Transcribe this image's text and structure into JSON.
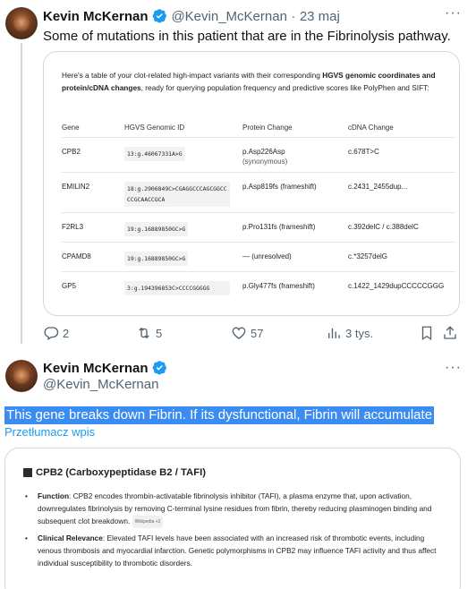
{
  "tweet1": {
    "author_name": "Kevin McKernan",
    "handle": "@Kevin_McKernan",
    "separator": "·",
    "date": "23 maj",
    "text": "Some of mutations in this patient that are in the Fibrinolysis pathway.",
    "image": {
      "intro_prefix": "Here's a table of your clot-related high-impact variants with their corresponding ",
      "intro_bold": "HGVS genomic coordinates and protein/cDNA changes",
      "intro_suffix": ", ready for querying population frequency and predictive scores like PolyPhen and SIFT:",
      "headers": [
        "Gene",
        "HGVS Genomic ID",
        "Protein Change",
        "cDNA Change"
      ],
      "rows": [
        {
          "gene": "CPB2",
          "hgvs": "13:g.46067331A>G",
          "protein": "p.Asp226Asp",
          "protein_note": "(synonymous)",
          "cdna": "c.678T>C"
        },
        {
          "gene": "EMILIN2",
          "hgvs": "18:g.2906849C>CGAGGCCCAGCGGCCCCGCAACCGCA",
          "protein": "p.Asp819fs (frameshift)",
          "protein_note": "",
          "cdna": "c.2431_2455dup..."
        },
        {
          "gene": "F2RL3",
          "hgvs": "19:g.16889850GC>G",
          "protein": "p.Pro131fs (frameshift)",
          "protein_note": "",
          "cdna": "c.392delC / c.388delC"
        },
        {
          "gene": "CPAMD8",
          "hgvs": "19:g.16889850GC>G",
          "protein": "— (unresolved)",
          "protein_note": "",
          "cdna": "c.*3257delG"
        },
        {
          "gene": "GP5",
          "hgvs": "3:g.194396853C>CCCCGGGGG",
          "protein": "p.Gly477fs (frameshift)",
          "protein_note": "",
          "cdna": "c.1422_1429dupCCCCCGGG"
        }
      ]
    },
    "actions": {
      "replies": "2",
      "reposts": "5",
      "likes": "57",
      "views": "3 tys."
    }
  },
  "tweet2": {
    "author_name": "Kevin McKernan",
    "handle": "@Kevin_McKernan",
    "text": "This gene breaks down Fibrin. If its dysfunctional, Fibrin will accumulate",
    "translate_link": "Przetłumacz wpis",
    "image": {
      "title": "CPB2 (Carboxypeptidase B2 / TAFI)",
      "bullets": [
        {
          "label": "Function",
          "text": ": CPB2 encodes thrombin-activatable fibrinolysis inhibitor (TAFI), a plasma enzyme that, upon activation, downregulates fibrinolysis by removing C-terminal lysine residues from fibrin, thereby reducing plasminogen binding and subsequent clot breakdown.",
          "cite": "Wikipedia +2"
        },
        {
          "label": "Clinical Relevance",
          "text": ": Elevated TAFI levels have been associated with an increased risk of thrombotic events, including venous thrombosis and myocardial infarction. Genetic polymorphisms in CPB2 may influence TAFI activity and thus affect individual susceptibility to thrombotic disorders.",
          "cite": ""
        }
      ]
    }
  },
  "colors": {
    "accent": "#1d9bf0",
    "verified": "#1d9bf0",
    "secondary_text": "#536471",
    "selection": "#3b8cf0"
  }
}
